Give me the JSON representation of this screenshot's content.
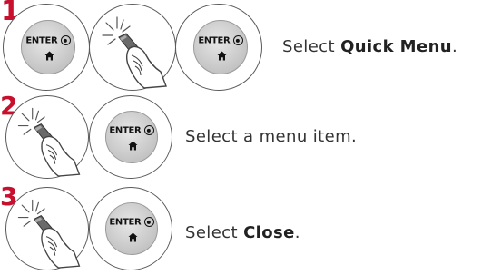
{
  "steps": [
    {
      "number": "1",
      "buttons": [
        "enter",
        "hand",
        "enter"
      ],
      "enter_label": "ENTER",
      "text_prefix": "Select ",
      "text_bold": "Quick Menu",
      "text_suffix": "."
    },
    {
      "number": "2",
      "buttons": [
        "hand",
        "enter"
      ],
      "enter_label": "ENTER",
      "text_prefix": "Select a menu item.",
      "text_bold": "",
      "text_suffix": ""
    },
    {
      "number": "3",
      "buttons": [
        "hand",
        "enter"
      ],
      "enter_label": "ENTER",
      "text_prefix": "Select ",
      "text_bold": "Close",
      "text_suffix": "."
    }
  ],
  "colors": {
    "step_number": "#c8102e",
    "circle_border": "#5a5a5a",
    "text": "#333333"
  },
  "icons": {
    "enter_button": "enter-wheel-button-icon",
    "hand_remote": "hand-pressing-remote-icon",
    "home": "home-icon"
  }
}
